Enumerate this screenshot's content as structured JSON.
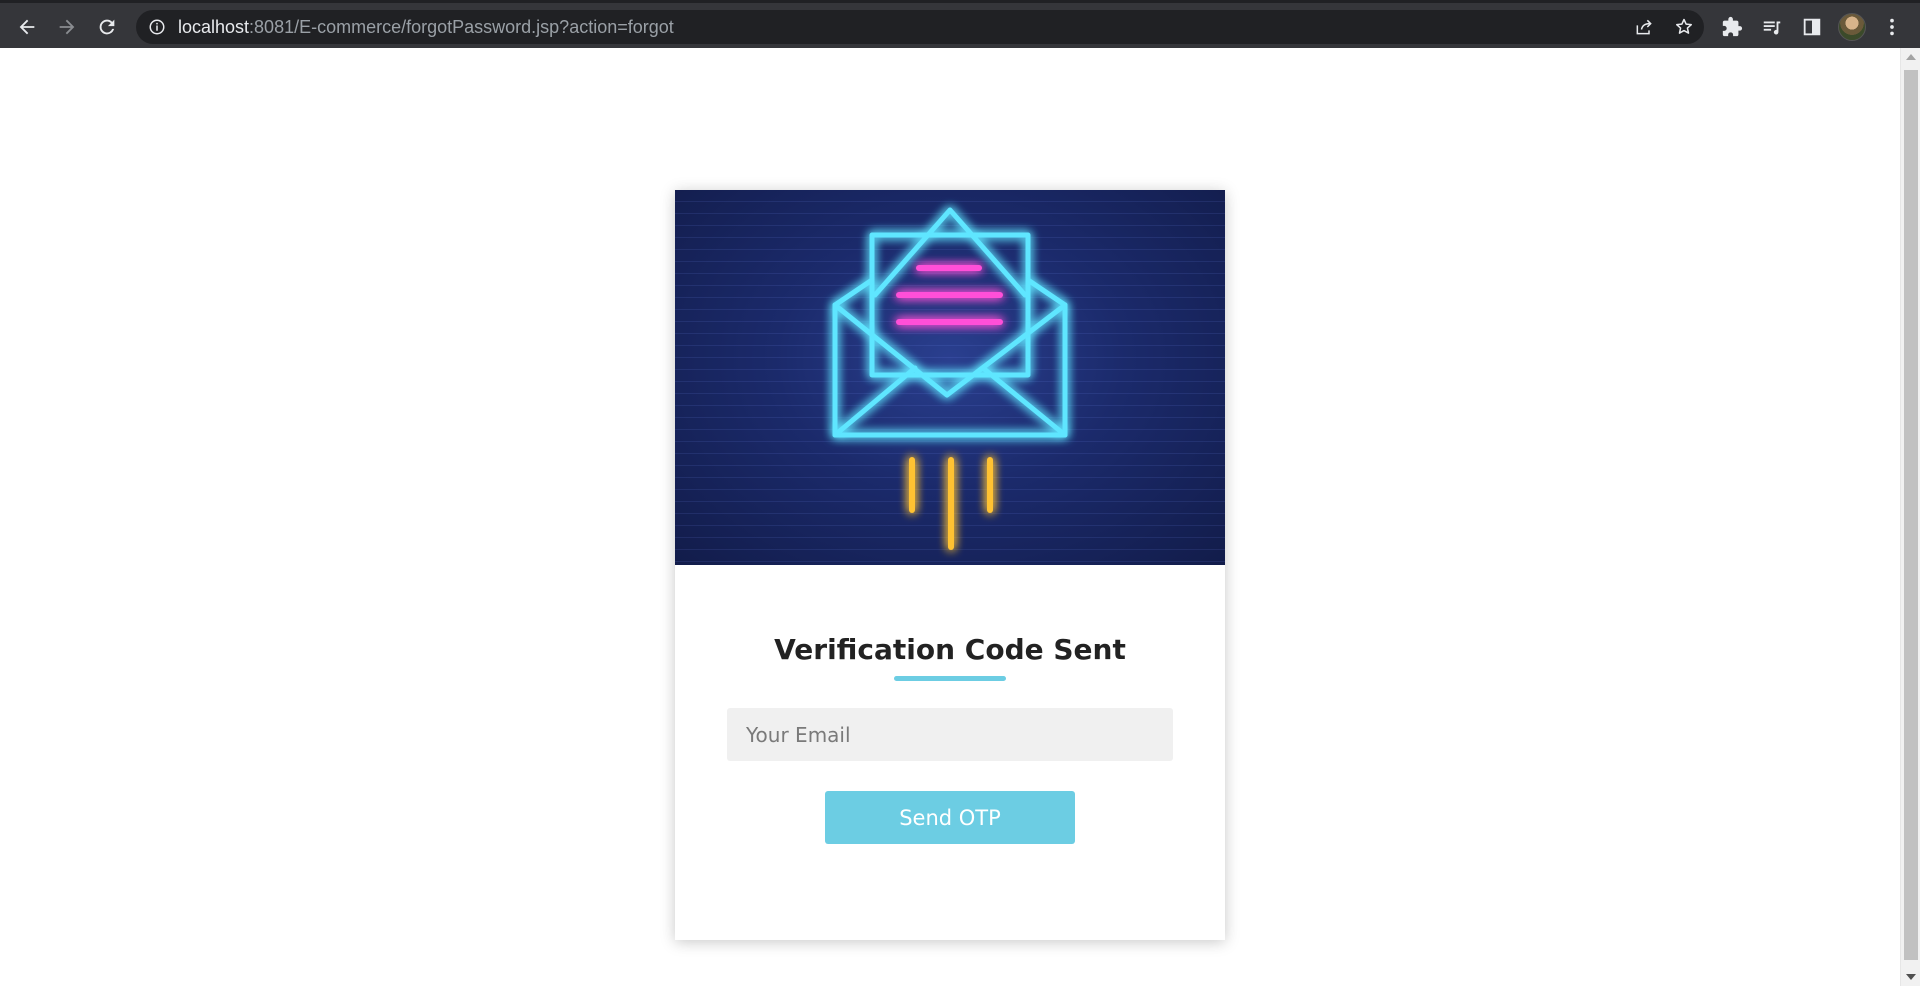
{
  "browser": {
    "url_host": "localhost",
    "url_rest": ":8081/E-commerce/forgotPassword.jsp?action=forgot",
    "icons": {
      "back": "back-arrow-icon",
      "forward": "forward-arrow-icon",
      "reload": "reload-icon",
      "site_info": "info-icon",
      "share": "share-icon",
      "bookmark": "star-icon",
      "extensions": "puzzle-icon",
      "reading_list": "reading-list-icon",
      "side_panel": "side-panel-icon",
      "menu": "kebab-menu-icon"
    }
  },
  "card": {
    "hero_image": "neon-envelope-illustration",
    "title": "Verification Code Sent",
    "email_placeholder": "Your Email",
    "email_value": "",
    "submit_label": "Send OTP"
  },
  "colors": {
    "accent": "#6ccde3",
    "chrome_bg": "#35363a",
    "omnibox_bg": "#202124",
    "hero_bg": "#1b2a6b",
    "neon_cyan": "#5ee6ff",
    "neon_pink": "#ff4fd8",
    "neon_yellow": "#ffc233"
  }
}
